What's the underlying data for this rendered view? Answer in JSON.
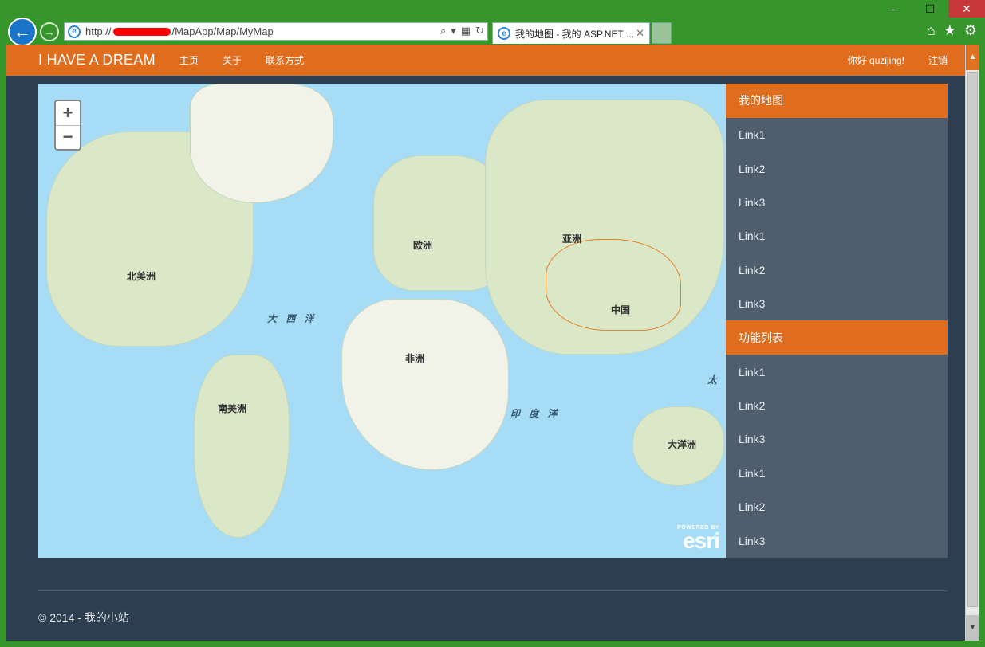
{
  "window": {
    "minimize_label": "–",
    "maximize_label": "☐",
    "close_label": "✕"
  },
  "browser": {
    "address_prefix": "http://",
    "address_suffix": "/MapApp/Map/MyMap",
    "tab_title": "我的地图 - 我的 ASP.NET ...",
    "tab_close": "✕",
    "ie_icon": "e",
    "back_icon": "←",
    "forward_icon": "→"
  },
  "navbar": {
    "brand": "I HAVE A DREAM",
    "links": [
      "主页",
      "关于",
      "联系方式"
    ],
    "greeting": "你好 quzijing!",
    "logout": "注销"
  },
  "map": {
    "zoom_in": "+",
    "zoom_out": "−",
    "labels": {
      "north_america": "北美洲",
      "south_america": "南美洲",
      "europe": "欧洲",
      "asia": "亚洲",
      "africa": "非洲",
      "china": "中国",
      "oceania": "大洋洲",
      "atlantic": "大 西 洋",
      "indian": "印 度 洋",
      "pacific": "太"
    },
    "attribution_small": "POWERED BY",
    "attribution_logo": "esri"
  },
  "sidebar": {
    "section1_title": "我的地图",
    "section1_items": [
      "Link1",
      "Link2",
      "Link3",
      "Link1",
      "Link2",
      "Link3"
    ],
    "section2_title": "功能列表",
    "section2_items": [
      "Link1",
      "Link2",
      "Link3",
      "Link1",
      "Link2",
      "Link3"
    ]
  },
  "footer": {
    "text": "© 2014 - 我的小站"
  },
  "colors": {
    "accent": "#e06c1e",
    "page_bg": "#2c3e50",
    "sidebar_bg": "#4f5d6d",
    "window_frame": "#37962b"
  }
}
